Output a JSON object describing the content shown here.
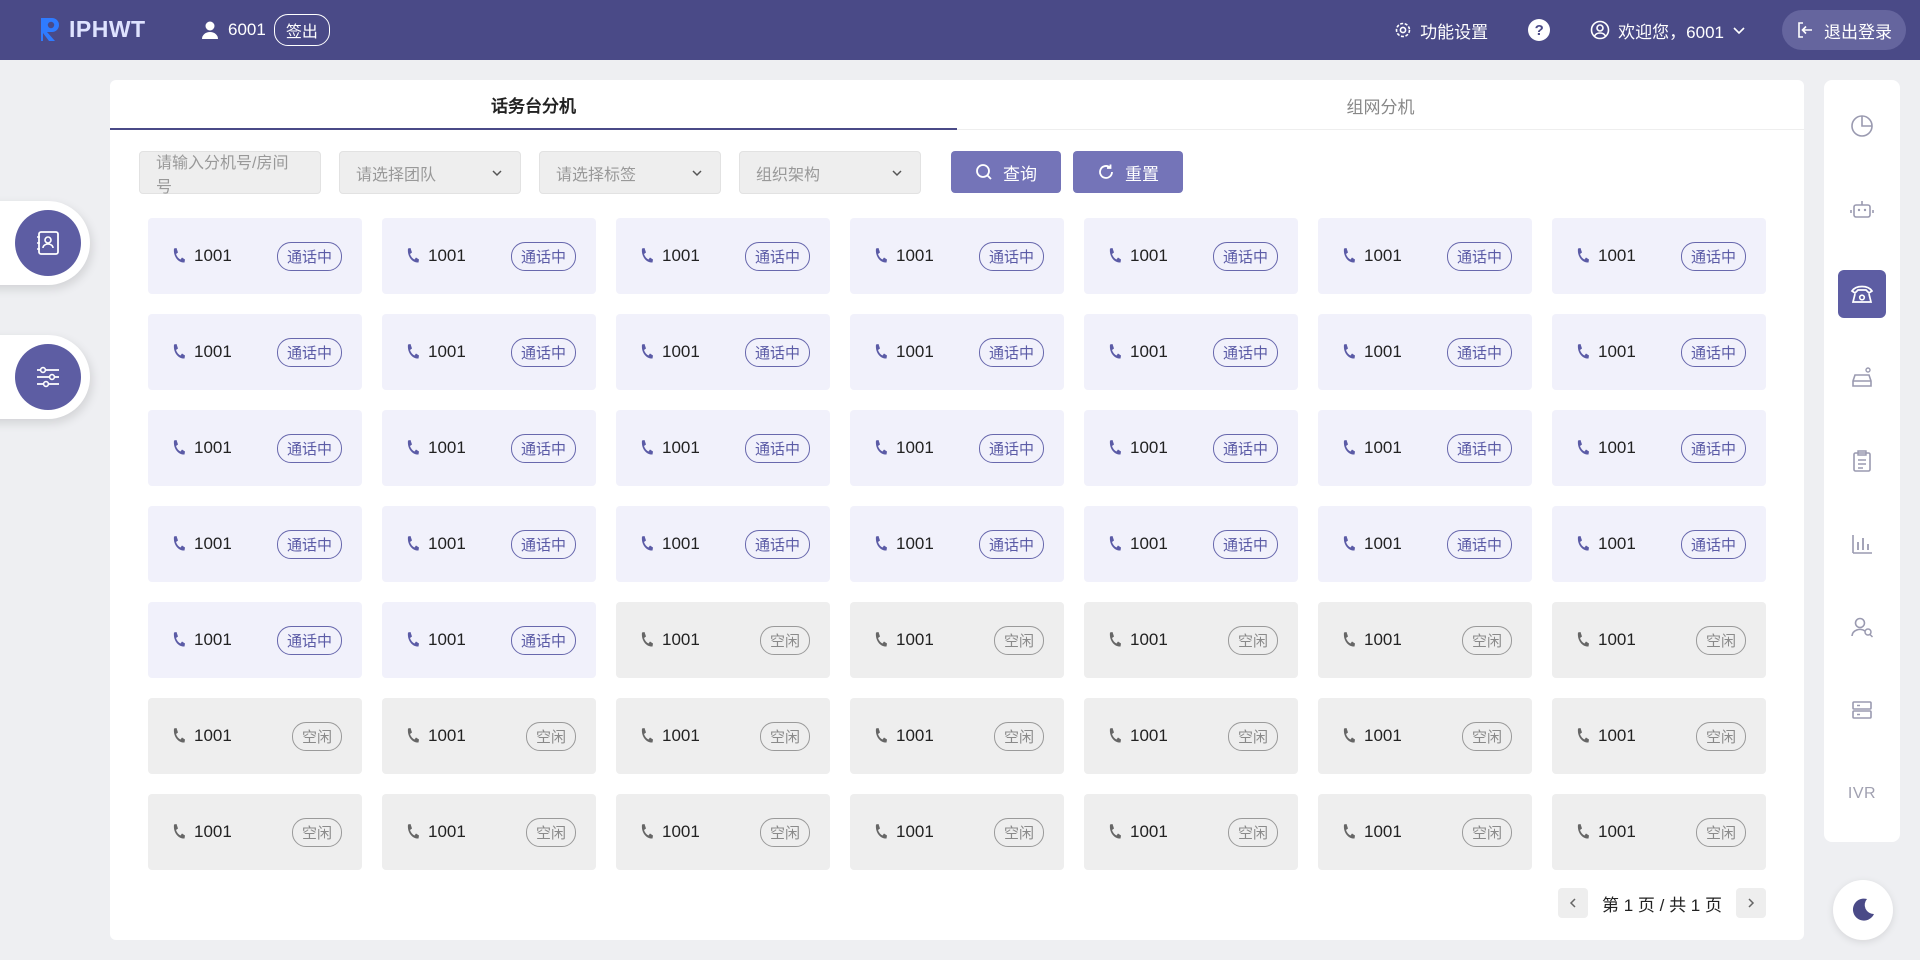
{
  "header": {
    "logo_text": "IPHWT",
    "user_number": "6001",
    "signout_label": "签出",
    "settings_label": "功能设置",
    "help_label": "?",
    "welcome_text": "欢迎您，6001",
    "logout_label": "退出登录"
  },
  "tabs": [
    {
      "label": "话务台分机",
      "active": true
    },
    {
      "label": "组网分机",
      "active": false
    }
  ],
  "filters": {
    "ext_placeholder": "请输入分机号/房间号",
    "team_placeholder": "请选择团队",
    "tag_placeholder": "请选择标签",
    "org_placeholder": "组织架构",
    "query_label": "查询",
    "reset_label": "重置"
  },
  "extensions": [
    {
      "number": "1001",
      "status": "通话中"
    },
    {
      "number": "1001",
      "status": "通话中"
    },
    {
      "number": "1001",
      "status": "通话中"
    },
    {
      "number": "1001",
      "status": "通话中"
    },
    {
      "number": "1001",
      "status": "通话中"
    },
    {
      "number": "1001",
      "status": "通话中"
    },
    {
      "number": "1001",
      "status": "通话中"
    },
    {
      "number": "1001",
      "status": "通话中"
    },
    {
      "number": "1001",
      "status": "通话中"
    },
    {
      "number": "1001",
      "status": "通话中"
    },
    {
      "number": "1001",
      "status": "通话中"
    },
    {
      "number": "1001",
      "status": "通话中"
    },
    {
      "number": "1001",
      "status": "通话中"
    },
    {
      "number": "1001",
      "status": "通话中"
    },
    {
      "number": "1001",
      "status": "通话中"
    },
    {
      "number": "1001",
      "status": "通话中"
    },
    {
      "number": "1001",
      "status": "通话中"
    },
    {
      "number": "1001",
      "status": "通话中"
    },
    {
      "number": "1001",
      "status": "通话中"
    },
    {
      "number": "1001",
      "status": "通话中"
    },
    {
      "number": "1001",
      "status": "通话中"
    },
    {
      "number": "1001",
      "status": "通话中"
    },
    {
      "number": "1001",
      "status": "通话中"
    },
    {
      "number": "1001",
      "status": "通话中"
    },
    {
      "number": "1001",
      "status": "通话中"
    },
    {
      "number": "1001",
      "status": "通话中"
    },
    {
      "number": "1001",
      "status": "通话中"
    },
    {
      "number": "1001",
      "status": "通话中"
    },
    {
      "number": "1001",
      "status": "通话中"
    },
    {
      "number": "1001",
      "status": "通话中"
    },
    {
      "number": "1001",
      "status": "空闲"
    },
    {
      "number": "1001",
      "status": "空闲"
    },
    {
      "number": "1001",
      "status": "空闲"
    },
    {
      "number": "1001",
      "status": "空闲"
    },
    {
      "number": "1001",
      "status": "空闲"
    },
    {
      "number": "1001",
      "status": "空闲"
    },
    {
      "number": "1001",
      "status": "空闲"
    },
    {
      "number": "1001",
      "status": "空闲"
    },
    {
      "number": "1001",
      "status": "空闲"
    },
    {
      "number": "1001",
      "status": "空闲"
    },
    {
      "number": "1001",
      "status": "空闲"
    },
    {
      "number": "1001",
      "status": "空闲"
    },
    {
      "number": "1001",
      "status": "空闲"
    },
    {
      "number": "1001",
      "status": "空闲"
    },
    {
      "number": "1001",
      "status": "空闲"
    },
    {
      "number": "1001",
      "status": "空闲"
    },
    {
      "number": "1001",
      "status": "空闲"
    },
    {
      "number": "1001",
      "status": "空闲"
    },
    {
      "number": "1001",
      "status": "空闲"
    }
  ],
  "pagination": {
    "text": "第 1 页 / 共 1 页"
  },
  "sidebar": {
    "items": [
      {
        "icon": "pie-chart-icon"
      },
      {
        "icon": "robot-icon"
      },
      {
        "icon": "phone-desk-icon",
        "active": true
      },
      {
        "icon": "car-service-icon"
      },
      {
        "icon": "clipboard-icon"
      },
      {
        "icon": "bar-chart-icon"
      },
      {
        "icon": "user-search-icon"
      },
      {
        "icon": "server-icon"
      },
      {
        "icon": "ivr-icon",
        "label": "IVR"
      }
    ]
  },
  "colors": {
    "header_bg": "#4a4a87",
    "accent": "#5d5da3",
    "button": "#7474b8",
    "busy_bg": "#f1f1fb",
    "idle_bg": "#eeeeee"
  }
}
